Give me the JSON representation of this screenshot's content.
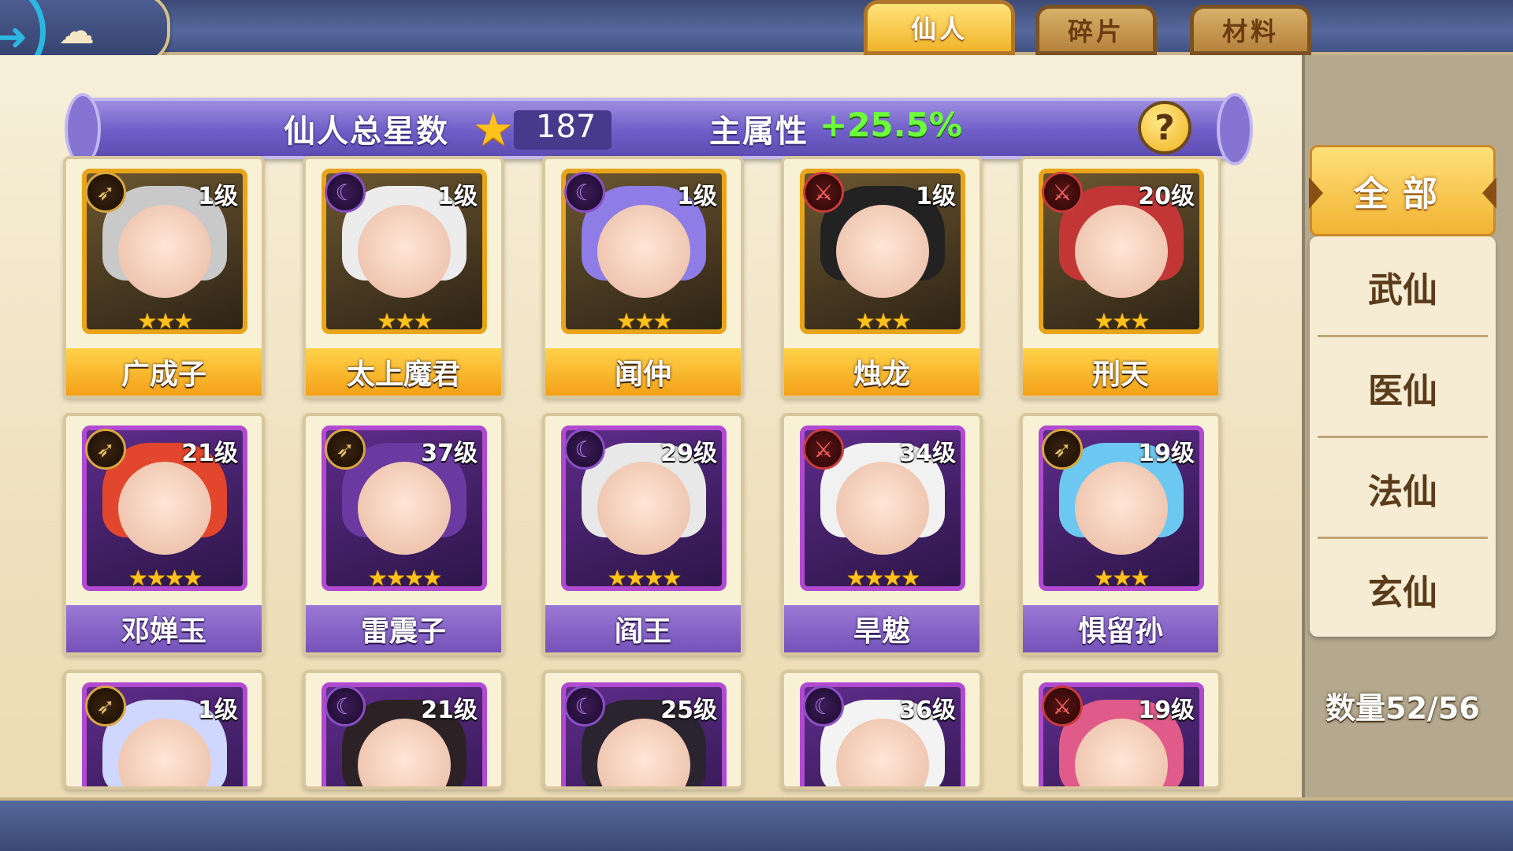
{
  "colors": {
    "accent_gold": "#f3a117",
    "accent_purple": "#7552b8",
    "attr_green": "#6dff3a",
    "back_blue": "#2bb7e0"
  },
  "tabs": [
    {
      "label": "仙人",
      "active": true
    },
    {
      "label": "碎片",
      "active": false
    },
    {
      "label": "材料",
      "active": false
    }
  ],
  "stats": {
    "total_stars_label": "仙人总星数",
    "total_stars": "187",
    "main_attr_label": "主属性",
    "main_attr_value": "+25.5%",
    "help": "?"
  },
  "filters": [
    {
      "label": "全部",
      "active": true
    },
    {
      "label": "武仙",
      "active": false
    },
    {
      "label": "医仙",
      "active": false
    },
    {
      "label": "法仙",
      "active": false
    },
    {
      "label": "玄仙",
      "active": false
    }
  ],
  "count_text": "数量52/56",
  "cards": [
    {
      "name": "广成子",
      "level": "1级",
      "stars": "★★★",
      "rarity": "gold",
      "role": "bow-icon"
    },
    {
      "name": "太上魔君",
      "level": "1级",
      "stars": "★★★",
      "rarity": "gold",
      "role": "staff-icon"
    },
    {
      "name": "闻仲",
      "level": "1级",
      "stars": "★★★",
      "rarity": "gold",
      "role": "staff-icon"
    },
    {
      "name": "烛龙",
      "level": "1级",
      "stars": "★★★",
      "rarity": "gold",
      "role": "sword-icon"
    },
    {
      "name": "刑天",
      "level": "20级",
      "stars": "★★★",
      "rarity": "gold",
      "role": "sword-icon"
    },
    {
      "name": "邓婵玉",
      "level": "21级",
      "stars": "★★★★",
      "rarity": "purple",
      "role": "bow-icon"
    },
    {
      "name": "雷震子",
      "level": "37级",
      "stars": "★★★★",
      "rarity": "purple",
      "role": "bow-icon"
    },
    {
      "name": "阎王",
      "level": "29级",
      "stars": "★★★★",
      "rarity": "purple",
      "role": "staff-icon"
    },
    {
      "name": "旱魃",
      "level": "34级",
      "stars": "★★★★",
      "rarity": "purple",
      "role": "sword-icon"
    },
    {
      "name": "惧留孙",
      "level": "19级",
      "stars": "★★★",
      "rarity": "purple",
      "role": "bow-icon"
    },
    {
      "name": "",
      "level": "1级",
      "stars": "",
      "rarity": "purple",
      "role": "bow-icon"
    },
    {
      "name": "",
      "level": "21级",
      "stars": "",
      "rarity": "purple",
      "role": "staff-icon"
    },
    {
      "name": "",
      "level": "25级",
      "stars": "",
      "rarity": "purple",
      "role": "staff-icon"
    },
    {
      "name": "",
      "level": "36级",
      "stars": "",
      "rarity": "purple",
      "role": "staff-icon"
    },
    {
      "name": "",
      "level": "19级",
      "stars": "",
      "rarity": "purple",
      "role": "sword-icon"
    }
  ]
}
